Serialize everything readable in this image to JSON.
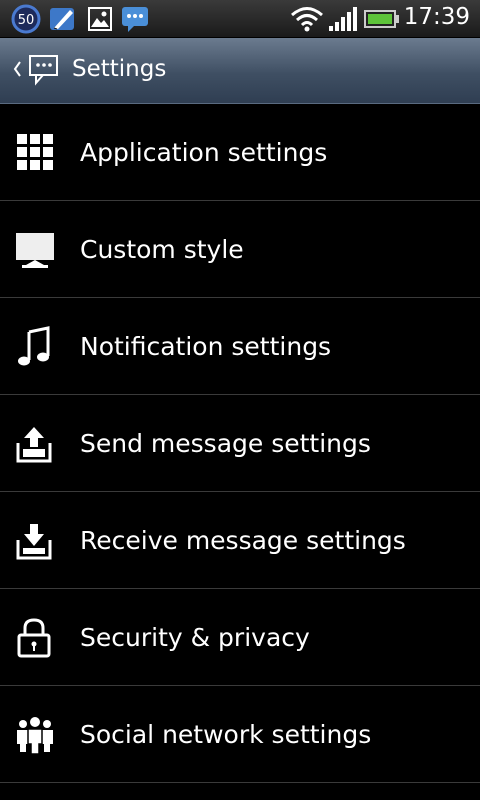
{
  "status_bar": {
    "badge_count": "50",
    "time": "17:39",
    "icons": [
      "badge-50-icon",
      "feather-icon",
      "image-icon",
      "message-notification-icon",
      "wifi-icon",
      "signal-icon",
      "battery-icon"
    ]
  },
  "header": {
    "title": "Settings",
    "icons": [
      "back-chevron-icon",
      "messaging-app-icon"
    ]
  },
  "menu": {
    "items": [
      {
        "label": "Application settings",
        "icon": "grid-icon"
      },
      {
        "label": "Custom style",
        "icon": "monitor-icon"
      },
      {
        "label": "Notification settings",
        "icon": "music-note-icon"
      },
      {
        "label": "Send message settings",
        "icon": "outbox-icon"
      },
      {
        "label": "Receive message settings",
        "icon": "inbox-icon"
      },
      {
        "label": "Security & privacy",
        "icon": "lock-icon"
      },
      {
        "label": "Social network settings",
        "icon": "people-icon"
      }
    ]
  },
  "colors": {
    "background": "#000000",
    "header_top": "#6b7b8f",
    "header_bottom": "#2f3e52",
    "divider": "#3a3a3a",
    "text": "#ffffff"
  }
}
